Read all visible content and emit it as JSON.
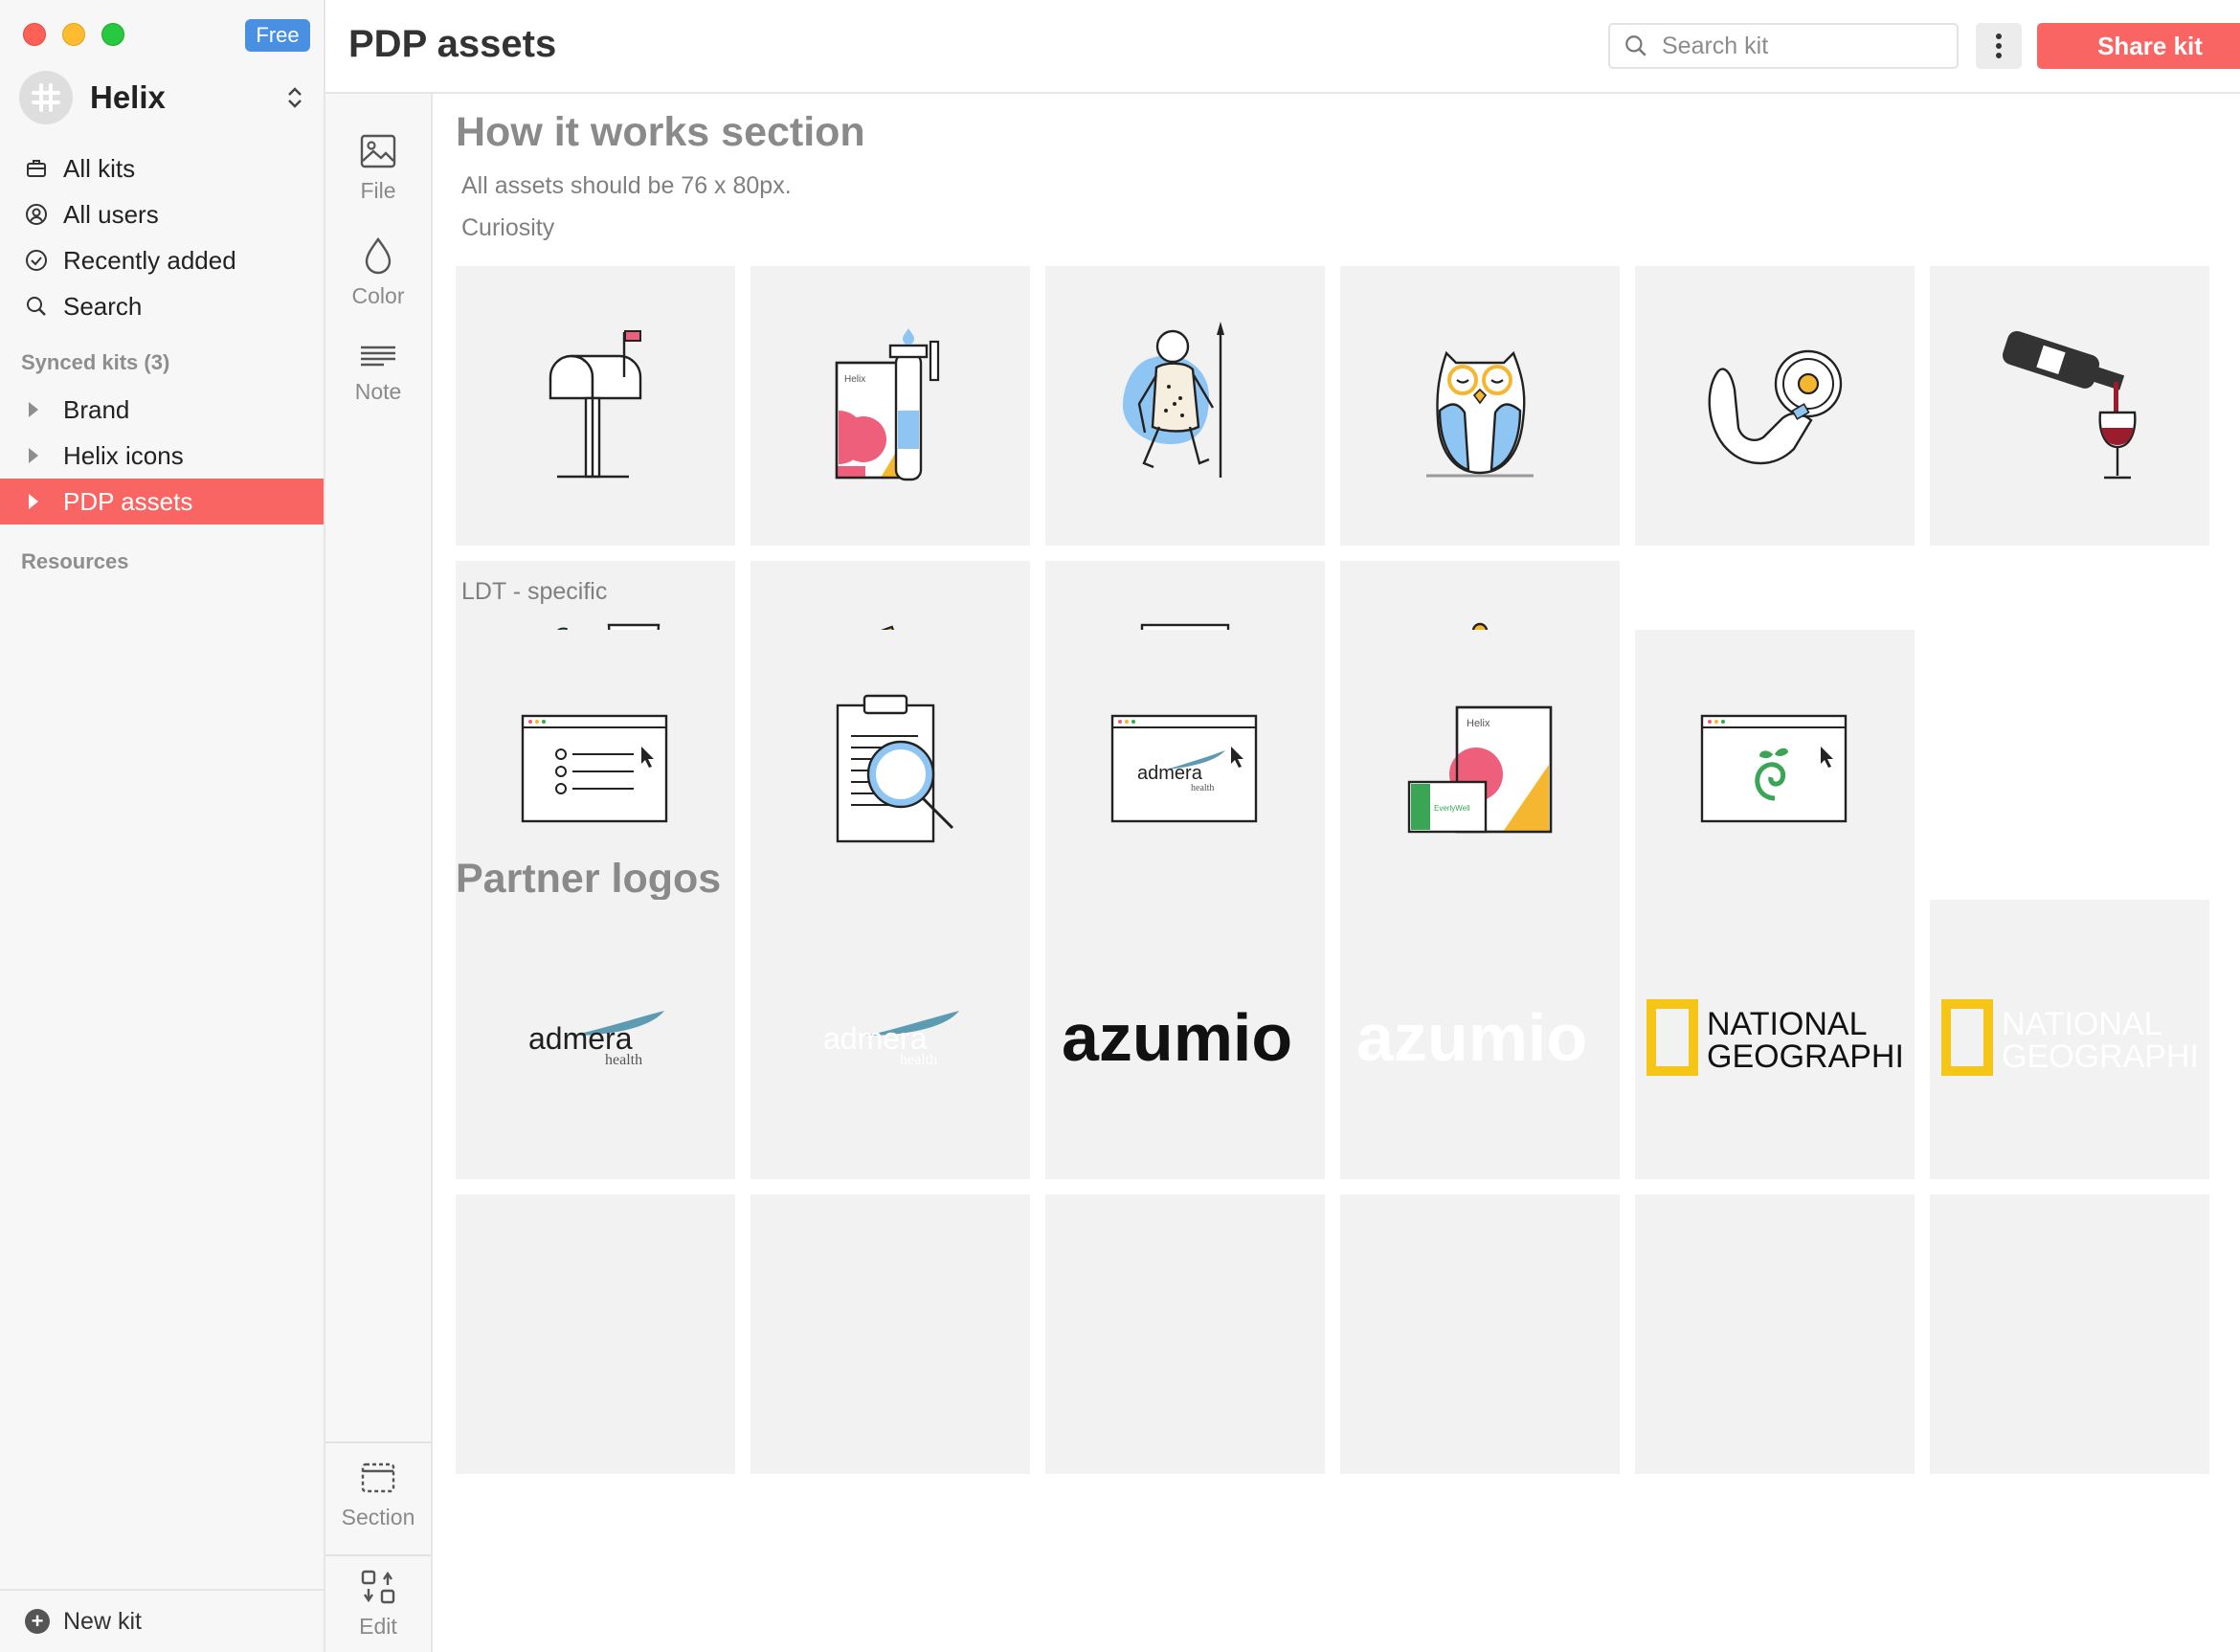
{
  "app": {
    "plan_badge": "Free",
    "workspace_name": "Helix"
  },
  "sidebar": {
    "nav": [
      {
        "label": "All kits"
      },
      {
        "label": "All users"
      },
      {
        "label": "Recently added"
      },
      {
        "label": "Search"
      }
    ],
    "synced_label": "Synced kits (3)",
    "kits": [
      {
        "label": "Brand"
      },
      {
        "label": "Helix icons"
      },
      {
        "label": "PDP assets"
      }
    ],
    "resources_label": "Resources",
    "new_kit_label": "New kit"
  },
  "rail": {
    "file": "File",
    "color": "Color",
    "note": "Note",
    "section": "Section",
    "edit": "Edit"
  },
  "header": {
    "title": "PDP assets",
    "search_placeholder": "Search kit",
    "share_label": "Share kit"
  },
  "content": {
    "section1_title": "How it works section",
    "section1_note": "All assets should be 76 x 80px.",
    "group1_label": "Curiosity",
    "group2_label": "LDT - specific",
    "section2_title": "Partner logos",
    "logos": {
      "admera": "admera",
      "admera_sub": "health",
      "azumio": "azumio",
      "natgeo_line1": "NATIONAL",
      "natgeo_line2": "GEOGRAPHIC",
      "helix": "Helix",
      "everlywell": "EverlyWell"
    }
  },
  "colors": {
    "accent": "#f86563",
    "badge": "#4a90e2",
    "illustration_yellow": "#f5b72f",
    "illustration_blue": "#8ec5f2",
    "illustration_pink": "#ee5f7b"
  }
}
